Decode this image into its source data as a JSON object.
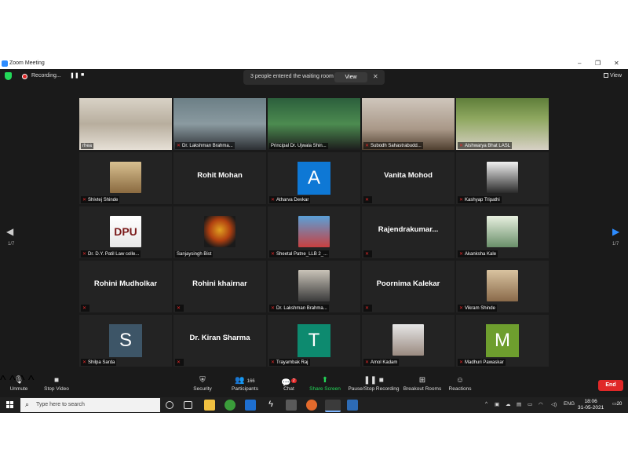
{
  "window": {
    "title": "Zoom Meeting",
    "minimize": "–",
    "maximize": "❐",
    "close": "✕"
  },
  "top_bar": {
    "recording_label": "Recording...",
    "pause_label": "❚❚",
    "stop_label": "■",
    "waiting_room_message": "3 people entered the waiting room",
    "view_button": "View",
    "close_symbol": "✕",
    "view_toggle": "View"
  },
  "gallery": {
    "page_left": "1/7",
    "page_right": "1/7",
    "tiles": [
      {
        "name": "rhea",
        "muted": false,
        "kind": "video"
      },
      {
        "name": "Dr. Lakshman Brahma...",
        "muted": true,
        "kind": "video"
      },
      {
        "name": "Principal Dr. Ujwala Shin...",
        "muted": false,
        "kind": "video"
      },
      {
        "name": "Subodh Sahastrabudd...",
        "muted": true,
        "kind": "video"
      },
      {
        "name": "Aishwarya Bhat LASL",
        "muted": true,
        "kind": "video"
      },
      {
        "name": "Shivtej Shinde",
        "muted": true,
        "kind": "photo"
      },
      {
        "name": "",
        "display_name": "Rohit Mohan",
        "muted": false,
        "kind": "text"
      },
      {
        "name": "Atharva Devkar",
        "muted": true,
        "kind": "letter",
        "letter": "A",
        "color": "#0e78d5"
      },
      {
        "name": "",
        "display_name": "Vanita Mohod",
        "muted": true,
        "kind": "text"
      },
      {
        "name": "Kashyap Tripathi",
        "muted": true,
        "kind": "photo"
      },
      {
        "name": "Dr. D.Y. Patil Law colle...",
        "muted": true,
        "kind": "photo",
        "photo_text": "DPU"
      },
      {
        "name": "Sanjaysingh Bist",
        "muted": false,
        "kind": "photo"
      },
      {
        "name": "Sheetal Patne_LLB 2_...",
        "muted": true,
        "kind": "photo"
      },
      {
        "name": "",
        "display_name": "Rajendrakumar...",
        "muted": true,
        "kind": "text"
      },
      {
        "name": "Akanksha Kale",
        "muted": true,
        "kind": "photo"
      },
      {
        "name": "",
        "display_name": "Rohini Mudholkar",
        "muted": true,
        "kind": "text"
      },
      {
        "name": "",
        "display_name": "Rohini khairnar",
        "muted": true,
        "kind": "text"
      },
      {
        "name": "Dr. Lakshman Brahma...",
        "muted": true,
        "kind": "photo"
      },
      {
        "name": "",
        "display_name": "Poornima Kalekar",
        "muted": true,
        "kind": "text"
      },
      {
        "name": "Vikram Shinde",
        "muted": true,
        "kind": "photo"
      },
      {
        "name": "Shilpa Sarda",
        "muted": true,
        "kind": "letter",
        "letter": "S",
        "color": "#3d5567"
      },
      {
        "name": "",
        "display_name": "Dr. Kiran Sharma",
        "muted": true,
        "kind": "text"
      },
      {
        "name": "Trayambak Raj",
        "muted": true,
        "kind": "letter",
        "letter": "T",
        "color": "#0d8a6f"
      },
      {
        "name": "Amol Kadam",
        "muted": true,
        "kind": "photo"
      },
      {
        "name": "Madhuri Pawaskar",
        "muted": true,
        "kind": "letter",
        "letter": "M",
        "color": "#6e9e2e"
      }
    ]
  },
  "toolbar": {
    "unmute": "Unmute",
    "stop_video": "Stop Video",
    "security": "Security",
    "participants": "Participants",
    "participants_count": "166",
    "chat": "Chat",
    "chat_badge": "2",
    "share_screen": "Share Screen",
    "recording": "Pause/Stop Recording",
    "breakout": "Breakout Rooms",
    "reactions": "Reactions",
    "end": "End",
    "accent": "#23d959",
    "end_color": "#e02828"
  },
  "taskbar": {
    "search_placeholder": "Type here to search",
    "language": "ENG",
    "time": "18:06",
    "date": "31-05-2021",
    "notifications": "20"
  }
}
